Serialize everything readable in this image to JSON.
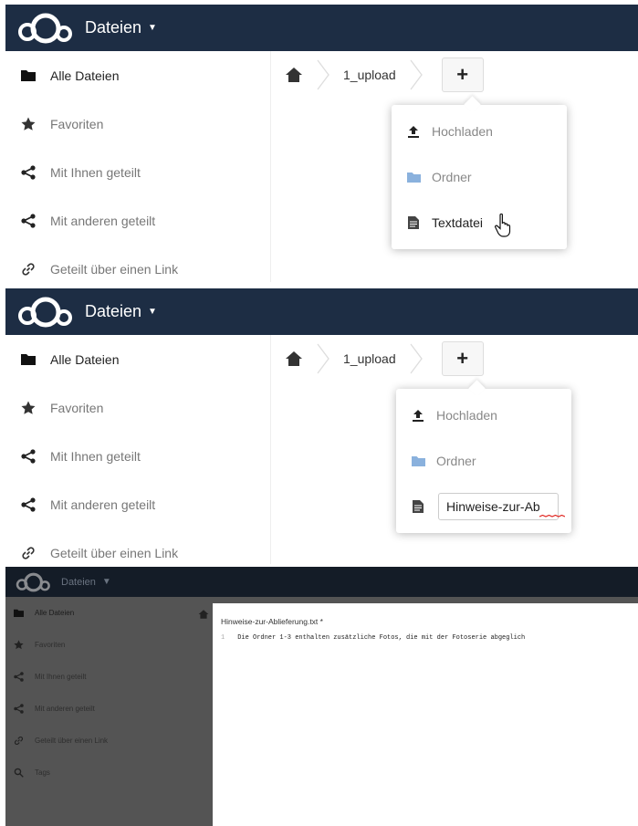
{
  "header": {
    "app_title": "Dateien",
    "logo_icon": "cloud-logo-icon",
    "dropdown_icon": "caret-down-icon"
  },
  "sidebar": {
    "items": [
      {
        "label": "Alle Dateien",
        "icon": "folder-icon"
      },
      {
        "label": "Favoriten",
        "icon": "star-icon"
      },
      {
        "label": "Mit Ihnen geteilt",
        "icon": "share-icon"
      },
      {
        "label": "Mit anderen geteilt",
        "icon": "share-icon"
      },
      {
        "label": "Geteilt über einen Link",
        "icon": "link-icon"
      },
      {
        "label": "Tags",
        "icon": "search-icon"
      }
    ]
  },
  "breadcrumb": {
    "home_icon": "home-icon",
    "folder": "1_upload",
    "add_label": "+"
  },
  "new_menu": {
    "upload_label": "Hochladen",
    "folder_label": "Ordner",
    "textfile_label": "Textdatei",
    "filename_value": "Hinweise-zur-Ab"
  },
  "editor": {
    "filename": "Hinweise-zur-Ablieferung.txt *",
    "line_number": "1",
    "line_text": "Die Ordner 1-3 enthalten zusätzliche Fotos, die mit der Fotoserie abgeglich"
  },
  "colors": {
    "header_bg": "#1d2d44",
    "folder_icon_blue": "#8ab1dd",
    "spellcheck_red": "#e0201b"
  }
}
